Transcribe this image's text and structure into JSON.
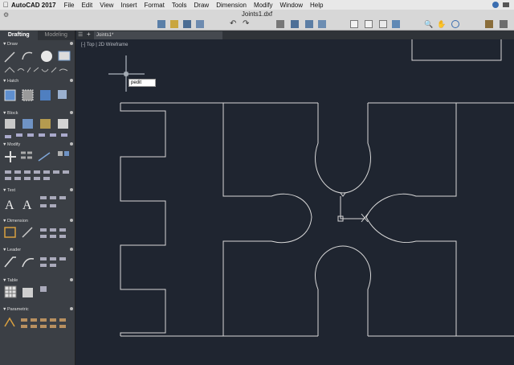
{
  "menubar": {
    "app_name": "AutoCAD 2017",
    "items": [
      "File",
      "Edit",
      "View",
      "Insert",
      "Format",
      "Tools",
      "Draw",
      "Dimension",
      "Modify",
      "Window",
      "Help"
    ]
  },
  "toolbar": {
    "title": "Joints1.dxf"
  },
  "palette": {
    "tabs": [
      "Drafting",
      "Modeling"
    ],
    "sections": [
      "Draw",
      "Hatch",
      "Block",
      "Modify",
      "Text",
      "Dimension",
      "Leader",
      "Table",
      "Parametric"
    ]
  },
  "document": {
    "tab_label": "Joints1*",
    "plus": "+",
    "viewport_label": "[-] Top | 2D Wireframe"
  },
  "command": {
    "input_value": "pedit"
  },
  "colors": {
    "canvas": "#1f2530",
    "palette": "#3b3f45",
    "linework": "#d8d8d8"
  }
}
